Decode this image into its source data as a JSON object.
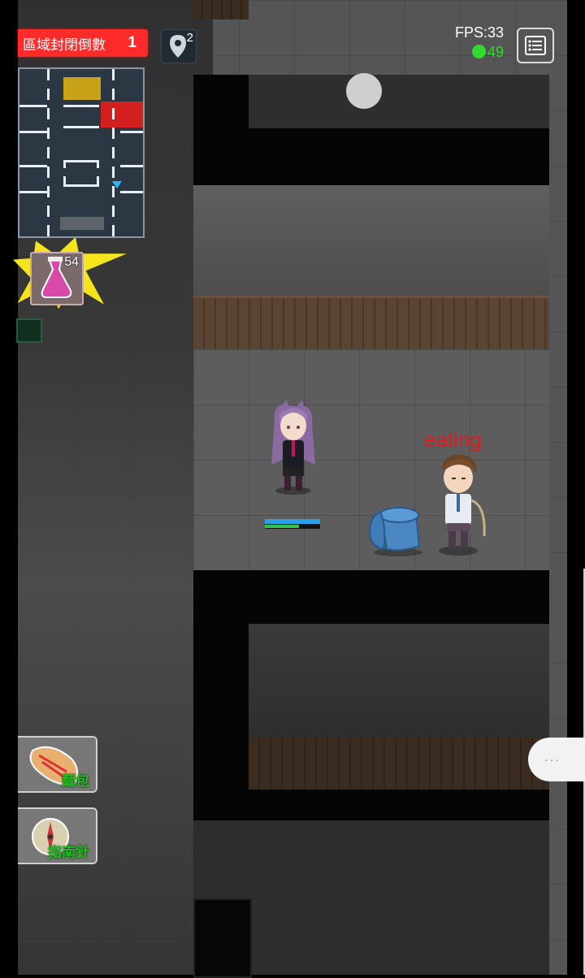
{
  "hud": {
    "countdown_label": "區域封閉倒數",
    "countdown_value": "1",
    "pin_count": "2",
    "fps": "FPS:33",
    "ping": "49",
    "menu_icon": "list-icon"
  },
  "inventory": {
    "potion_count": "54"
  },
  "world": {
    "npc_status": "eating"
  },
  "skills": [
    {
      "label": "麵包",
      "icon": "bread-icon"
    },
    {
      "label": "指南針",
      "icon": "compass-icon"
    }
  ],
  "chat": {
    "label": "···"
  },
  "colors": {
    "countdown_bg": "#ff2b2b",
    "ping_green": "#2fdc2f",
    "status_red": "#e21c1c",
    "skill_label_green": "#1fbf1f",
    "minimap_yellow": "#c8a31a",
    "minimap_red": "#d41f1f",
    "player_marker": "#27b7ff"
  }
}
